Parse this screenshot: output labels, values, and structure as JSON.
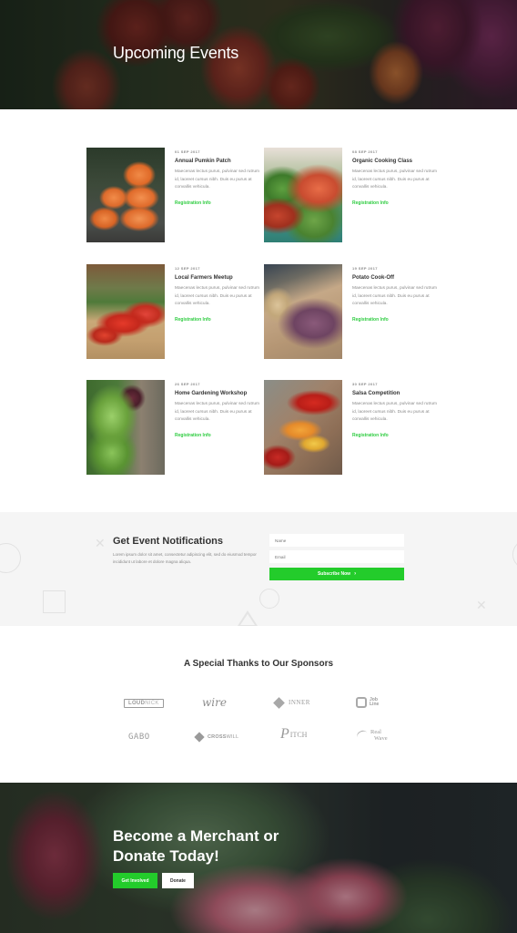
{
  "hero": {
    "title": "Upcoming Events"
  },
  "events": [
    {
      "date": "01 SEP 2017",
      "title": "Annual Pumkin Patch",
      "description": "Maecenas lectus purus, pulvinar sed rutrum id, laoreet cursus nibh. Duis eu purus at convallis vehicula.",
      "link": "Registration Info",
      "image": "pumpkins"
    },
    {
      "date": "08 SEP 2017",
      "title": "Organic Cooking Class",
      "description": "Maecenas lectus purus, pulvinar sed rutrum id, laoreet cursus nibh. Duis eu purus at convallis vehicula.",
      "link": "Registration Info",
      "image": "vegetable-baskets"
    },
    {
      "date": "12 SEP 2017",
      "title": "Local Farmers Meetup",
      "description": "Maecenas lectus purus, pulvinar sed rutrum id, laoreet cursus nibh. Duis eu purus at convallis vehicula.",
      "link": "Registration Info",
      "image": "tomato-baskets"
    },
    {
      "date": "19 SEP 2017",
      "title": "Potato Cook-Off",
      "description": "Maecenas lectus purus, pulvinar sed rutrum id, laoreet cursus nibh. Duis eu purus at convallis vehicula.",
      "link": "Registration Info",
      "image": "potato-crate"
    },
    {
      "date": "26 SEP 2017",
      "title": "Home Gardening Workshop",
      "description": "Maecenas lectus purus, pulvinar sed rutrum id, laoreet cursus nibh. Duis eu purus at convallis vehicula.",
      "link": "Registration Info",
      "image": "lettuce"
    },
    {
      "date": "30 SEP 2017",
      "title": "Salsa Competition",
      "description": "Maecenas lectus purus, pulvinar sed rutrum id, laoreet cursus nibh. Duis eu purus at convallis vehicula.",
      "link": "Registration Info",
      "image": "peppers"
    }
  ],
  "notifications": {
    "title": "Get Event Notifications",
    "text": "Lorem ipsum dolor sit amet, consectetur adipiscing elit, sed do eiusmod tempor incididunt ut labore et dolore magna aliqua.",
    "name_placeholder": "Name",
    "email_placeholder": "Email",
    "subscribe_label": "Subscribe Now",
    "subscribe_icon": "chevron-right-icon",
    "accent_color": "#23cc2b"
  },
  "sponsors": {
    "title": "A Special Thanks to Our Sponsors",
    "logos": [
      {
        "name": "LoudNick",
        "part1": "LOUD",
        "part2": "NICK"
      },
      {
        "name": "wire",
        "text": "wire"
      },
      {
        "name": "Inner",
        "text": "INNER"
      },
      {
        "name": "Job Line",
        "line1": "Job",
        "line2": "Line"
      },
      {
        "name": "GABO",
        "text": "GABO"
      },
      {
        "name": "Crosswill",
        "part1": "CROSS",
        "part2": "WILL"
      },
      {
        "name": "Pitch",
        "initial": "P",
        "text": "ITCH"
      },
      {
        "name": "Real Wave",
        "line1": "Real",
        "line2": "Wave"
      }
    ]
  },
  "cta": {
    "title": "Become a Merchant or Donate Today!",
    "primary_label": "Get Involved",
    "secondary_label": "Donate"
  }
}
